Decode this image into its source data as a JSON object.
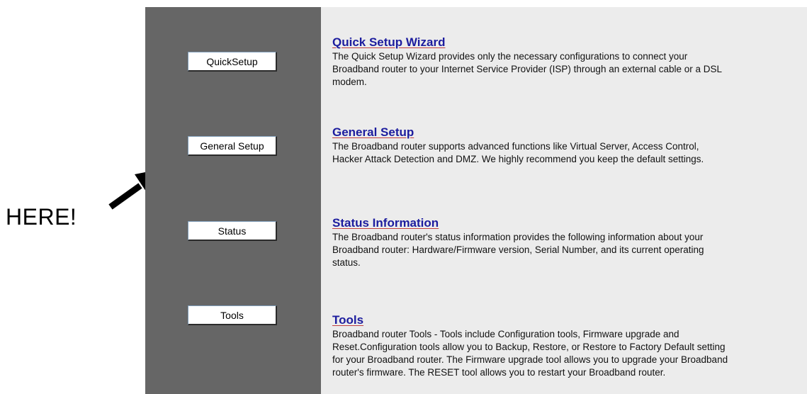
{
  "annotation": {
    "text": "HERE!"
  },
  "sidebar": {
    "buttons": [
      {
        "label": "QuickSetup"
      },
      {
        "label": "General Setup"
      },
      {
        "label": "Status"
      },
      {
        "label": "Tools"
      }
    ]
  },
  "content": {
    "sections": [
      {
        "title": "Quick Setup Wizard",
        "description": "The Quick Setup Wizard provides only the necessary configurations to connect your Broadband router to your Internet Service Provider (ISP) through an external cable or a DSL modem."
      },
      {
        "title": "General Setup",
        "description": "The Broadband router supports advanced functions like Virtual Server, Access Control, Hacker Attack Detection and DMZ. We highly recommend you keep the default settings."
      },
      {
        "title": "Status Information",
        "description": "The Broadband router's status information provides the following information about your Broadband router: Hardware/Firmware version, Serial Number, and its current operating status."
      },
      {
        "title": "Tools",
        "description": "Broadband router Tools - Tools include Configuration tools, Firmware upgrade and Reset.Configuration tools allow you to Backup, Restore, or Restore to Factory Default setting for your Broadband router. The Firmware upgrade tool allows you to upgrade your Broadband router's firmware. The RESET tool allows you to restart your Broadband router."
      }
    ]
  },
  "colors": {
    "sidebar_bg": "#666666",
    "content_bg": "#ececec",
    "link_color": "#1c1c9e",
    "link_underline": "#c04040"
  },
  "icons": {
    "annotation_arrow": "arrow-up-right-icon"
  }
}
